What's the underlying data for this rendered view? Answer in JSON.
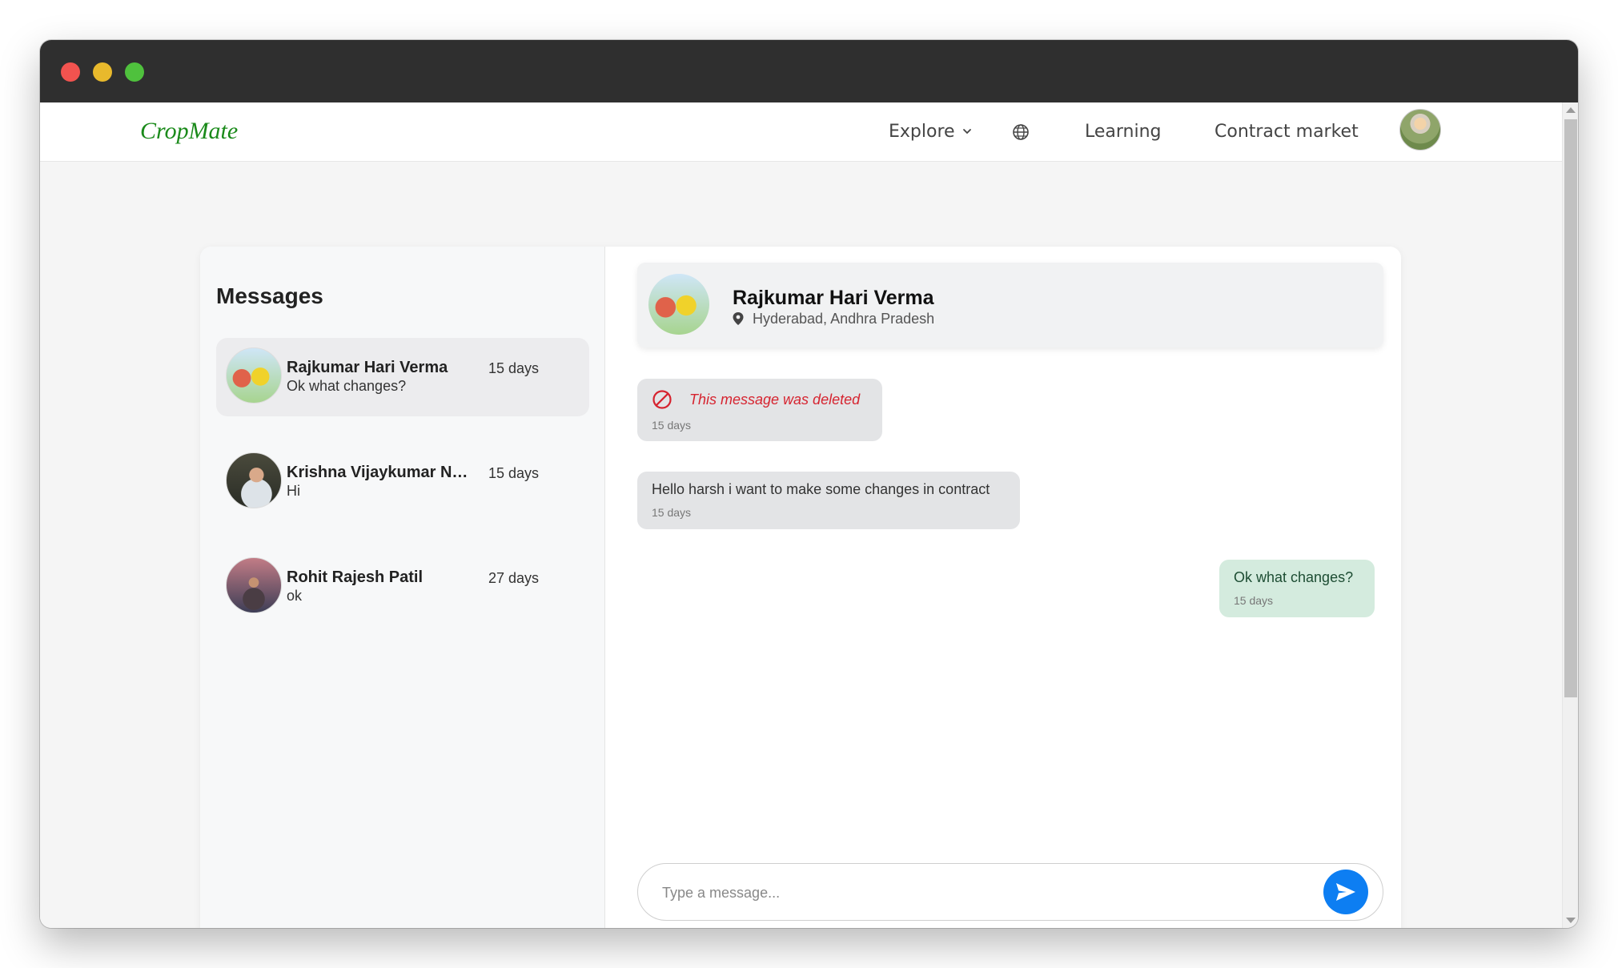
{
  "navbar": {
    "brand": "CropMate",
    "explore_label": "Explore",
    "learning_label": "Learning",
    "contract_market_label": "Contract market"
  },
  "sidebar": {
    "title": "Messages",
    "conversations": [
      {
        "name": "Rajkumar Hari Verma",
        "time": "15 days",
        "last_message": "Ok what changes?",
        "active": true
      },
      {
        "name": "Krishna Vijaykumar Naidu",
        "time": "15 days",
        "last_message": "Hi",
        "active": false
      },
      {
        "name": "Rohit Rajesh Patil",
        "time": "27 days",
        "last_message": "ok",
        "active": false
      }
    ]
  },
  "chat": {
    "contact_name": "Rajkumar Hari Verma",
    "contact_location": "Hyderabad, Andhra Pradesh",
    "messages": [
      {
        "text": "This message was deleted",
        "time": "15 days",
        "direction": "in",
        "deleted": true
      },
      {
        "text": "Hello harsh i want to make some changes in contract",
        "time": "15 days",
        "direction": "in",
        "deleted": false
      },
      {
        "text": "Ok what changes?",
        "time": "15 days",
        "direction": "out",
        "deleted": false
      }
    ],
    "composer_placeholder": "Type a message..."
  },
  "colors": {
    "brand": "#1a8a1a",
    "deleted_text": "#d6232f",
    "incoming_bubble": "#e3e4e6",
    "outgoing_bubble": "#d4ebde",
    "send_button": "#0d7ef2"
  },
  "icons": {
    "explore_chevron": "chevron-down-icon",
    "language": "globe-icon",
    "location": "map-pin-icon",
    "deleted": "ban-icon",
    "send": "send-icon"
  }
}
